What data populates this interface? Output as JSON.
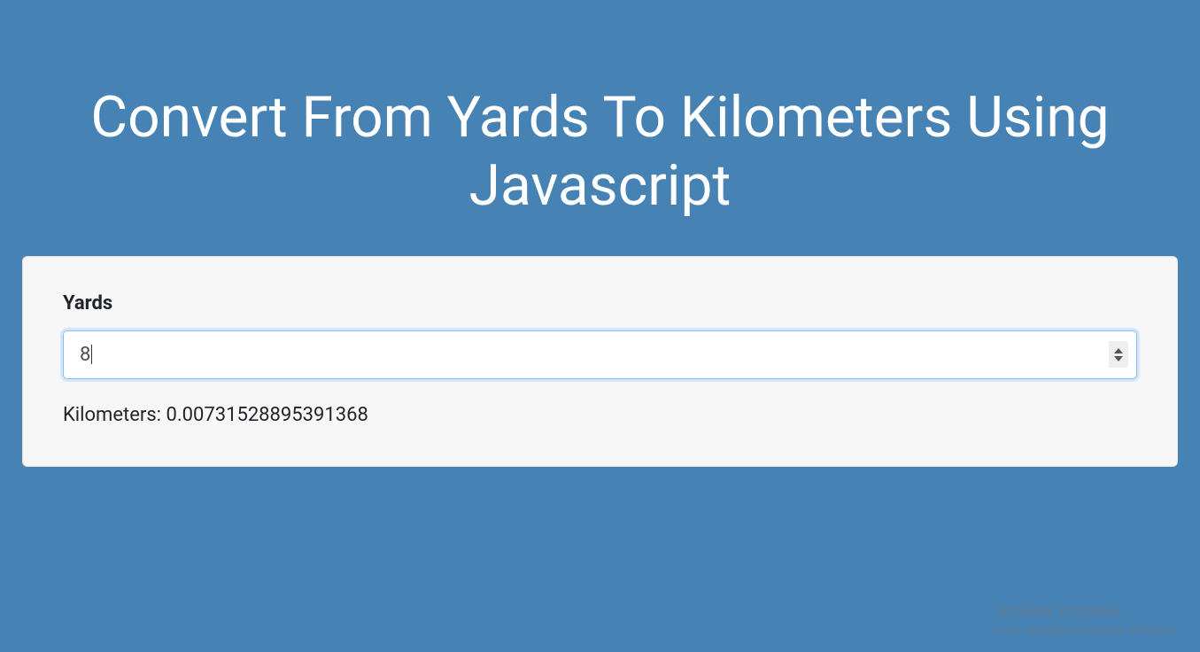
{
  "page": {
    "title": "Convert From Yards To Kilometers Using Javascript"
  },
  "form": {
    "yards_label": "Yards",
    "yards_value": "8",
    "result_prefix": "Kilometers: ",
    "result_value": "0.0073152889539136​8"
  },
  "watermark": {
    "title": "Activate Windows",
    "subtitle": "Go to Settings to activate Windows."
  },
  "colors": {
    "background": "#4682B4",
    "card_bg": "#f7f7f7",
    "input_border_focus": "#80bdff"
  }
}
